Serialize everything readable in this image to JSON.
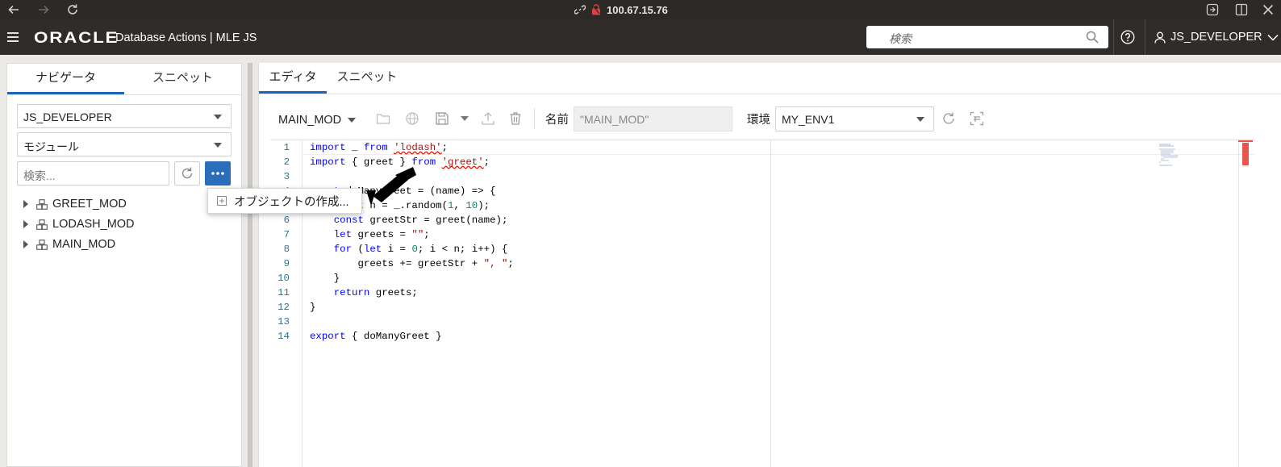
{
  "browser": {
    "url": "100.67.15.76",
    "icons": [
      "back-arrow-icon",
      "forward-arrow-icon",
      "reload-icon",
      "link-icon",
      "lock-insecure-icon",
      "translate-icon",
      "split-view-icon",
      "close-icon"
    ]
  },
  "appbar": {
    "logo_text": "ORACLE",
    "title": "Database Actions | MLE JS",
    "search_placeholder": "検索",
    "user": "JS_DEVELOPER"
  },
  "left": {
    "tabs": [
      "ナビゲータ",
      "スニペット"
    ],
    "schema": "JS_DEVELOPER",
    "object_type": "モジュール",
    "search_placeholder": "検索...",
    "tree_items": [
      "GREET_MOD",
      "LODASH_MOD",
      "MAIN_MOD"
    ],
    "popup_item": "オブジェクトの作成..."
  },
  "right": {
    "tabs": [
      "エディタ",
      "スニペット"
    ],
    "module_select": "MAIN_MOD",
    "name_label": "名前",
    "name_value": "\"MAIN_MOD\"",
    "env_label": "環境",
    "env_value": "MY_ENV1"
  },
  "editor": {
    "line_numbers": [
      "1",
      "2",
      "3",
      "4",
      "5",
      "6",
      "7",
      "8",
      "9",
      "10",
      "11",
      "12",
      "13",
      "14"
    ],
    "lines": [
      "import _ from 'lodash';",
      "import { greet } from 'greet';",
      "",
      "const doManyGreet = (name) => {",
      "    const n = _.random(1, 10);",
      "    const greetStr = greet(name);",
      "    let greets = \"\";",
      "    for (let i = 0; i < n; i++) {",
      "        greets += greetStr + \", \";",
      "    }",
      "    return greets;",
      "}",
      "",
      "export { doManyGreet }"
    ]
  },
  "colors": {
    "accent_blue": "#2a6ebb",
    "appbar_bg": "#2f2c29",
    "keyword": "#0000ff",
    "string": "#a31515",
    "number": "#098658",
    "error_marker": "#e8554e"
  }
}
